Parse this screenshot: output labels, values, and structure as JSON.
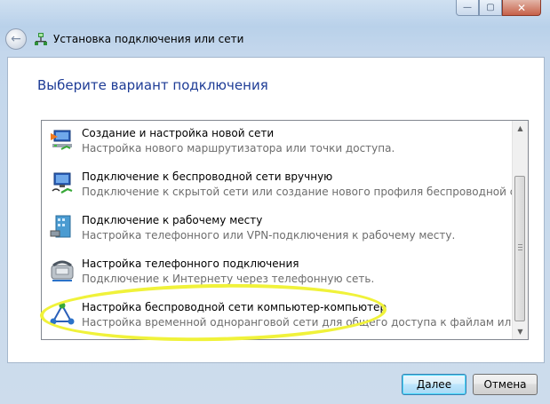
{
  "window": {
    "title": "Установка подключения или сети",
    "controls": {
      "minimize": "—",
      "maximize": "▢",
      "close": "✕"
    }
  },
  "main": {
    "heading": "Выберите вариант подключения",
    "options": [
      {
        "title": "Создание и настройка новой сети",
        "description": "Настройка нового маршрутизатора или точки доступа.",
        "icon": "network-setup-icon"
      },
      {
        "title": "Подключение к беспроводной сети вручную",
        "description": "Подключение к скрытой сети или создание нового профиля беспроводной связи.",
        "icon": "wireless-manual-icon"
      },
      {
        "title": "Подключение к рабочему месту",
        "description": "Настройка телефонного или VPN-подключения к рабочему месту.",
        "icon": "workplace-icon"
      },
      {
        "title": "Настройка телефонного подключения",
        "description": "Подключение к Интернету через телефонную сеть.",
        "icon": "dialup-phone-icon"
      },
      {
        "title": "Настройка беспроводной сети компьютер-компьютер",
        "description": "Настройка временной одноранговой сети для общего доступа к файлам или к Инт...",
        "icon": "adhoc-network-icon"
      }
    ]
  },
  "footer": {
    "next_label": "Далее",
    "cancel_label": "Отмена"
  },
  "colors": {
    "heading": "#1e3c96",
    "highlight": "#f0f23a"
  }
}
